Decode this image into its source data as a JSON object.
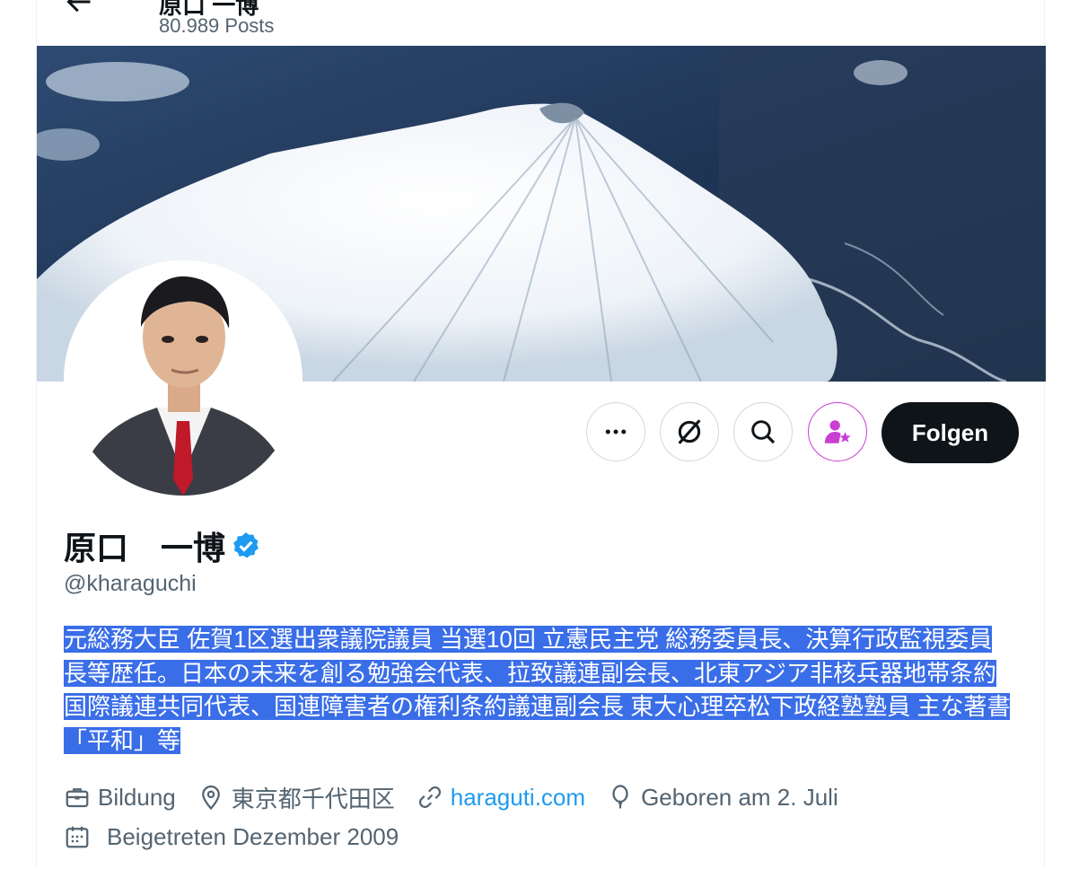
{
  "header": {
    "name": "原口 一博",
    "posts": "80.989 Posts"
  },
  "profile": {
    "name": "原口　一博",
    "handle": "@kharaguchi",
    "bio": "元総務大臣 佐賀1区選出衆議院議員 当選10回 立憲民主党 総務委員長、決算行政監視委員長等歴任。日本の未来を創る勉強会代表、拉致議連副会長、北東アジア非核兵器地帯条約国際議連共同代表、国連障害者の権利条約議連副会長 東大心理卒松下政経塾塾員 主な著書「平和」等"
  },
  "actions": {
    "follow_label": "Folgen",
    "icons": [
      "more-icon",
      "grok-icon",
      "search-icon",
      "subscribe-icon"
    ]
  },
  "meta": {
    "category": "Bildung",
    "location": "東京都千代田区",
    "website": "haraguti.com",
    "birthday": "Geboren am 2. Juli",
    "joined": "Beigetreten Dezember 2009"
  },
  "colors": {
    "accent": "#1d9bf0",
    "follow_bg": "#0f1419",
    "selection": "#3a6ee8",
    "subscribe": "#c93fd4"
  }
}
